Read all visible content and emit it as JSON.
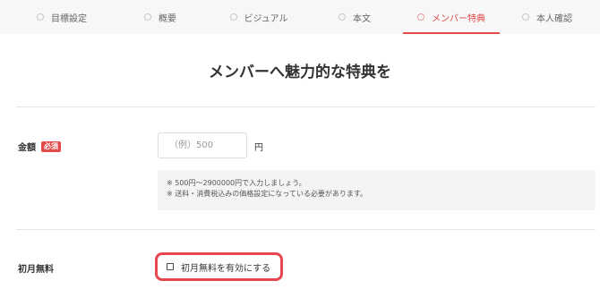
{
  "steps": [
    {
      "label": "目標設定",
      "active": false
    },
    {
      "label": "概要",
      "active": false
    },
    {
      "label": "ビジュアル",
      "active": false
    },
    {
      "label": "本文",
      "active": false
    },
    {
      "label": "メンバー特典",
      "active": true
    },
    {
      "label": "本人確認",
      "active": false
    }
  ],
  "colors": {
    "accent": "#e24a4a",
    "nav_background": "#f7f7f7",
    "note_background": "#f4f4f4"
  },
  "page": {
    "heading": "メンバーへ魅力的な特典を"
  },
  "amount_field": {
    "label": "金額",
    "required_badge": "必須",
    "placeholder": "（例）500",
    "value": "",
    "unit": "円",
    "notes": [
      "※ 500円〜2900000円で入力しましょう。",
      "※ 送料・消費税込みの価格設定になっている必要があります。"
    ]
  },
  "first_month_free": {
    "label": "初月無料",
    "checkbox_label": "初月無料を有効にする",
    "checked": false
  }
}
